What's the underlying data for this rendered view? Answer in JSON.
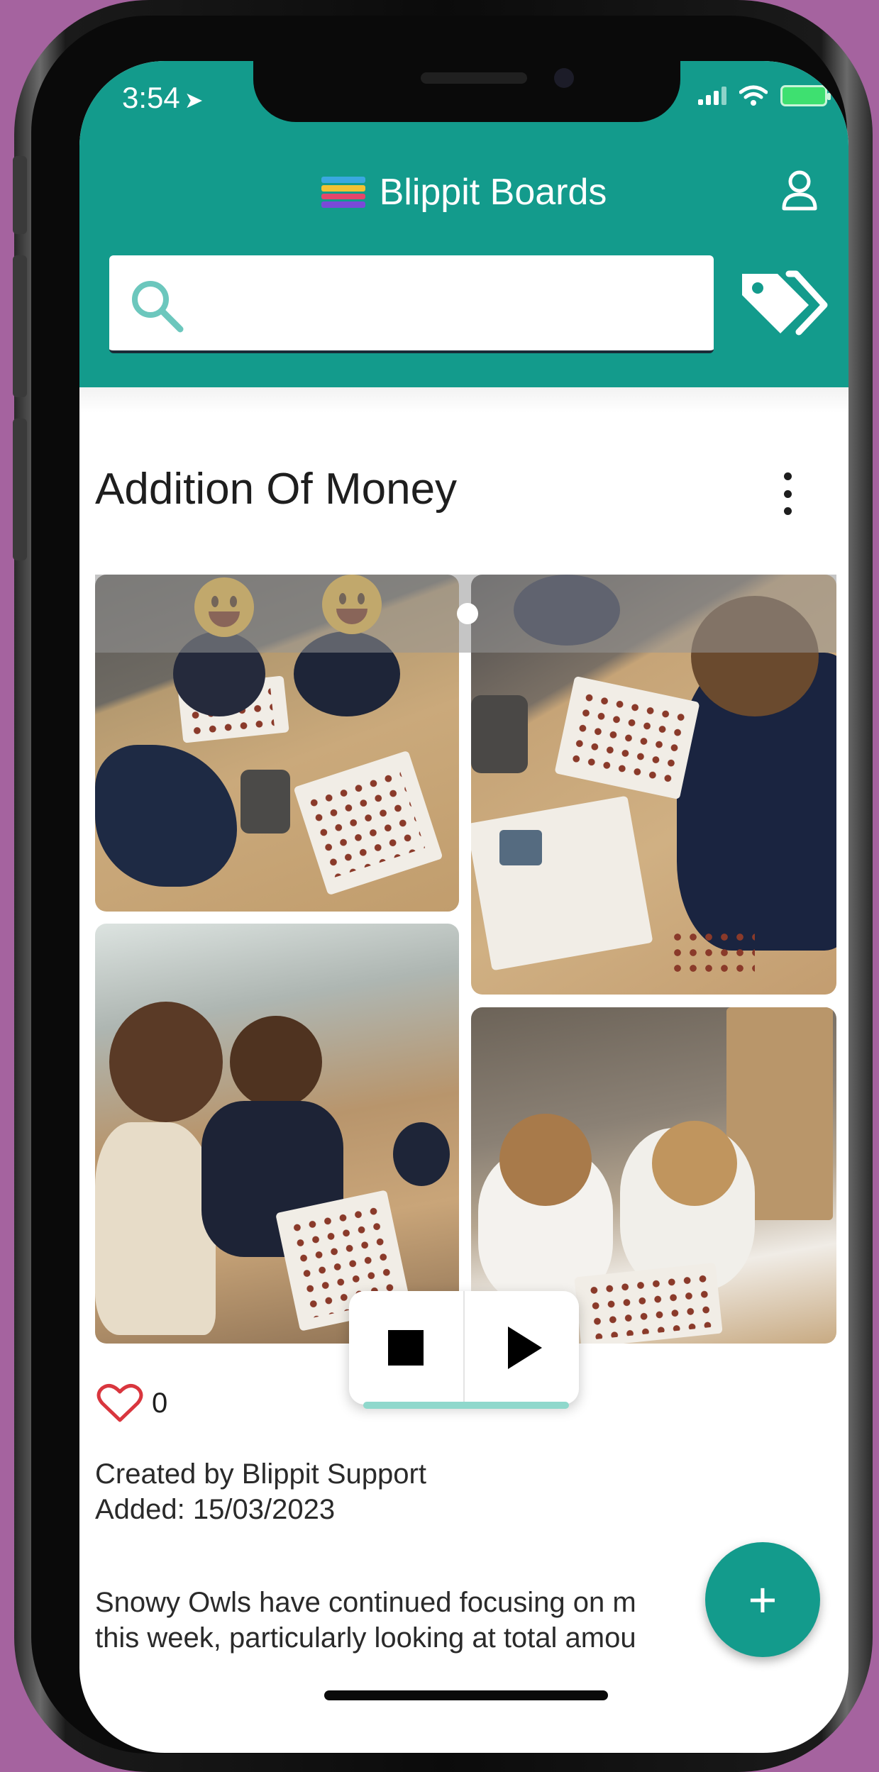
{
  "status_bar": {
    "time": "3:54",
    "location_arrow": "location-arrow-icon",
    "icons": [
      "signal-icon",
      "wifi-icon",
      "battery-charging-icon"
    ]
  },
  "header": {
    "title": "Blippit Boards",
    "logo": "blippit-logo-icon",
    "account_icon": "user-icon",
    "background_color": "#139b8c"
  },
  "search": {
    "value": "",
    "placeholder": "",
    "icon": "search-icon",
    "tags_icon": "tags-icon"
  },
  "board": {
    "title": "Addition Of Money",
    "menu_icon": "kebab-menu-icon",
    "photos": [
      "photo-1",
      "photo-2",
      "photo-3",
      "photo-4"
    ],
    "carousel_indicator": "page-dot",
    "media": {
      "stop_icon": "stop-icon",
      "play_icon": "play-icon"
    },
    "likes": {
      "icon": "heart-icon",
      "count": "0"
    },
    "created_by": "Created by Blippit Support",
    "added": "Added: 15/03/2023",
    "description_line1": "Snowy Owls have continued focusing on m",
    "description_line2": "this week, particularly looking at total amou"
  },
  "fab": {
    "label": "+",
    "icon": "plus-icon"
  },
  "colors": {
    "accent": "#139b8c",
    "heart": "#d9363e",
    "background": "#a5639f"
  }
}
